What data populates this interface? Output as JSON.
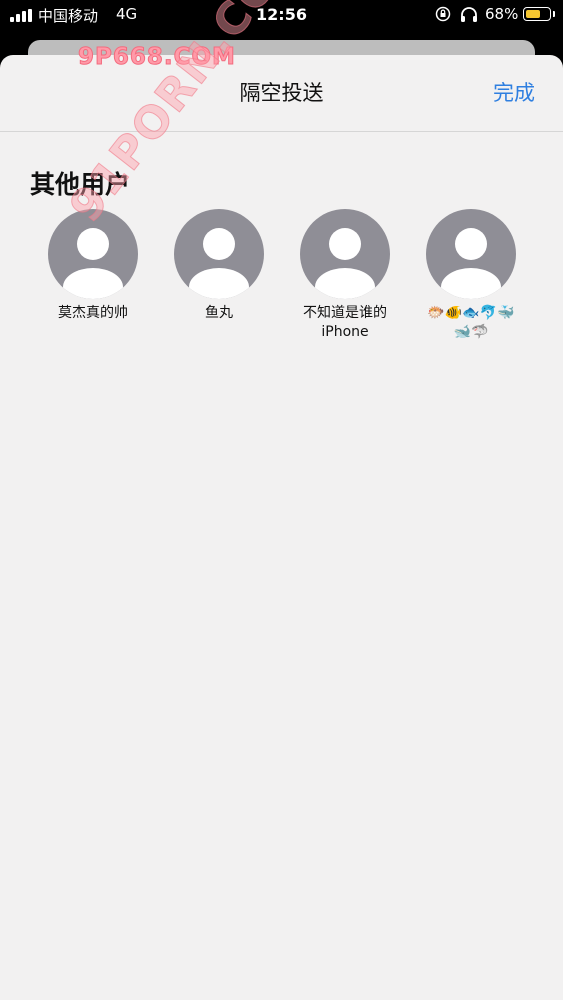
{
  "status_bar": {
    "carrier": "中国移动",
    "network": "4G",
    "time": "12:56",
    "battery_percent": "68%",
    "battery_level": 0.68,
    "battery_color": "#f5c630"
  },
  "watermark": {
    "top": "9P668.COM",
    "diagonal": "91PORN.COM"
  },
  "sheet": {
    "title": "隔空投送",
    "done_label": "完成"
  },
  "section": {
    "title": "其他用户"
  },
  "contacts": [
    {
      "name": "莫杰真的帅"
    },
    {
      "name": "鱼丸"
    },
    {
      "name_line1": "不知道是谁的",
      "name_line2": "iPhone"
    },
    {
      "name_line1": "🐡🐠🐟🐬🐳",
      "name_line2": "🐋🦈"
    }
  ],
  "colors": {
    "accent": "#2f7fe0",
    "avatar": "#8f8e96"
  }
}
